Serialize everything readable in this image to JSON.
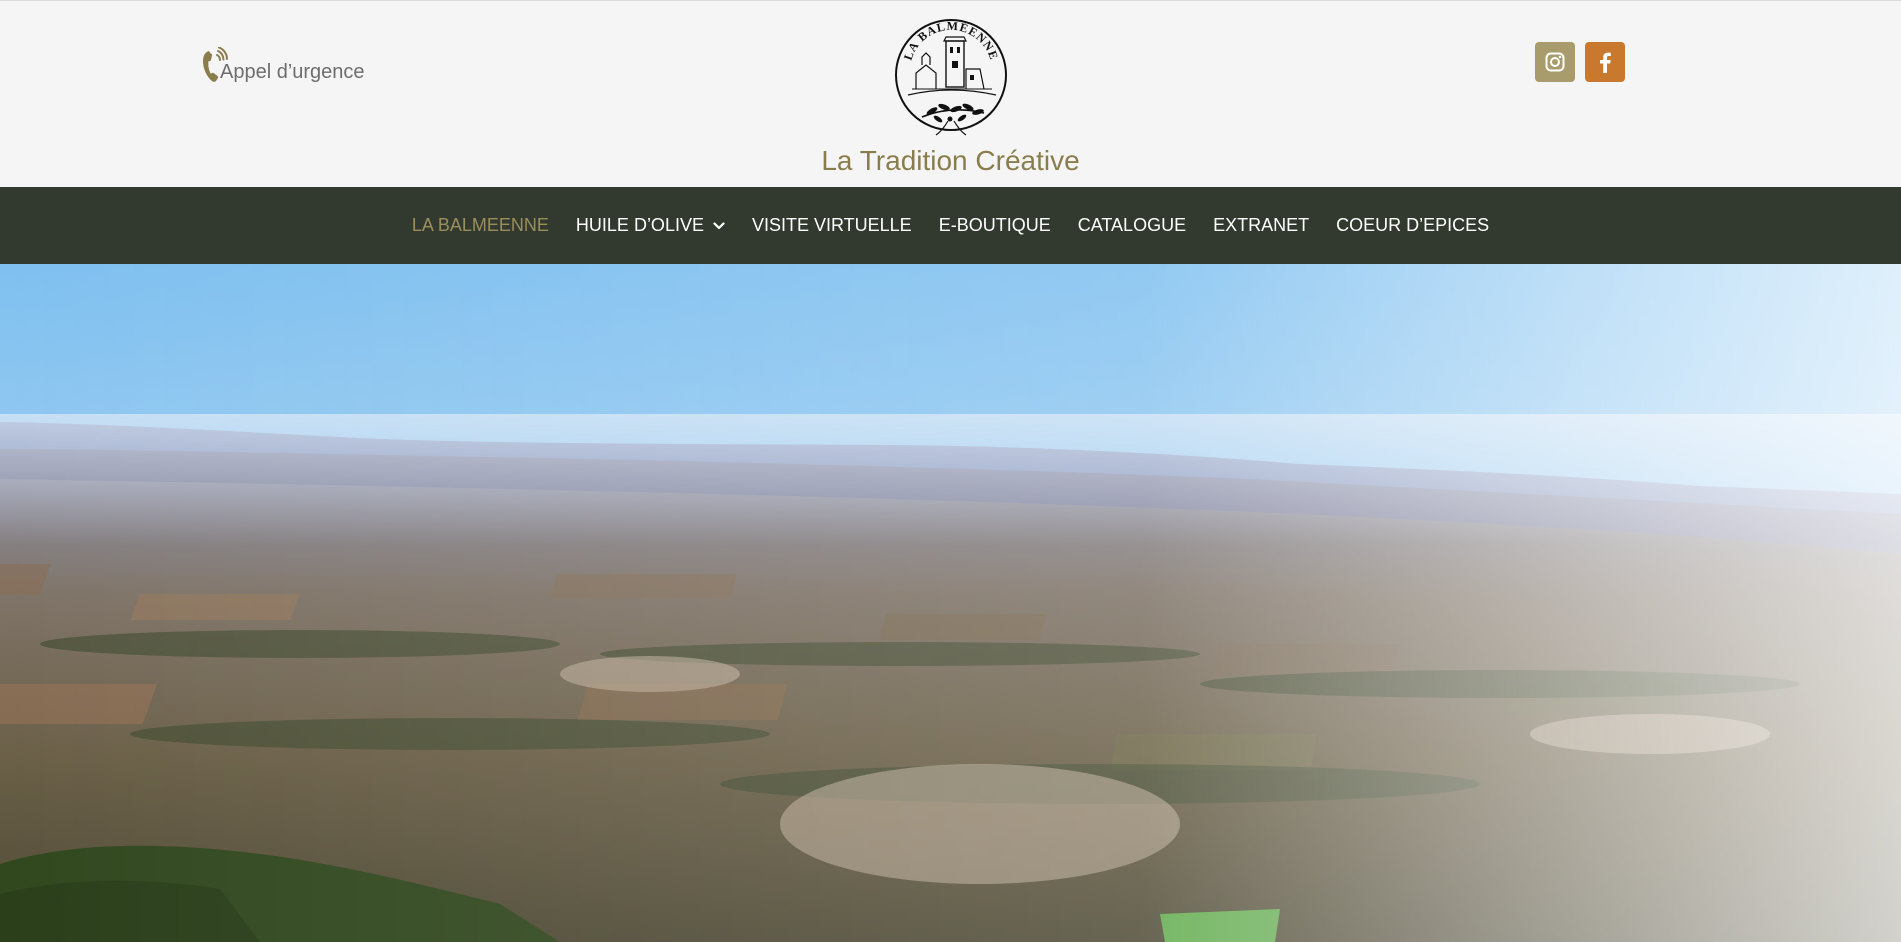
{
  "header": {
    "emergency_label": "Appel d’urgence",
    "logo_text": "LA BALMÉENNE",
    "tagline": "La Tradition Créative",
    "social": [
      {
        "name": "instagram",
        "icon": "instagram-icon",
        "color": "#a89c6d"
      },
      {
        "name": "facebook",
        "icon": "facebook-icon",
        "color": "#c8792e"
      }
    ]
  },
  "nav": {
    "items": [
      {
        "label": "LA BALMEENNE",
        "active": true
      },
      {
        "label": "HUILE D’OLIVE",
        "has_dropdown": true
      },
      {
        "label": "VISITE VIRTUELLE"
      },
      {
        "label": "E-BOUTIQUE"
      },
      {
        "label": "CATALOGUE"
      },
      {
        "label": "EXTRANET"
      },
      {
        "label": "COEUR D’EPICES"
      }
    ]
  },
  "colors": {
    "accent": "#8a7d4c",
    "nav_bg": "#323a30",
    "nav_active": "#9b8e5c",
    "instagram_bg": "#a89c6d",
    "facebook_bg": "#c8792e"
  }
}
